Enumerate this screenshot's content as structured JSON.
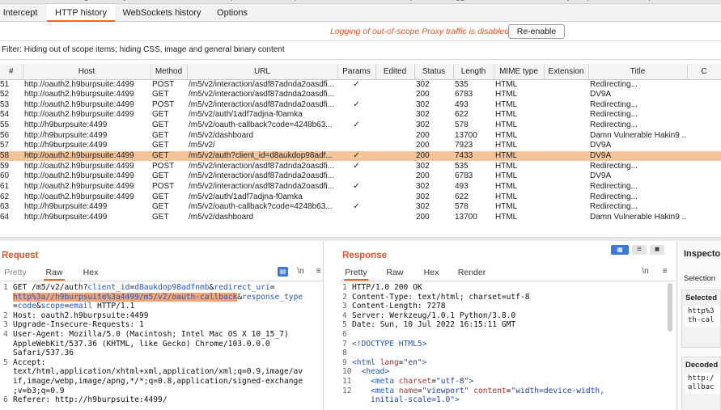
{
  "top_strip": [
    "Dashboard",
    "Target",
    "Proxy",
    "Intruder",
    "Repeater",
    "Sequencer",
    "Decoder",
    "Comparer",
    "Logger",
    "Extender",
    "Project options",
    "User options",
    "Learn"
  ],
  "tabs": [
    "Intercept",
    "HTTP history",
    "WebSockets history",
    "Options"
  ],
  "active_tab": "HTTP history",
  "log_message": "Logging of out-of-scope Proxy traffic is disabled",
  "reenable_label": "Re-enable",
  "filter_text": "Filter: Hiding out of scope items;  hiding CSS, image and general binary content",
  "columns": [
    "#",
    "Host",
    "Method",
    "URL",
    "Params",
    "Edited",
    "Status",
    "Length",
    "MIME type",
    "Extension",
    "Title",
    "C"
  ],
  "rows": [
    [
      "51",
      "http://oauth2.h9burpsuite:4499",
      "POST",
      "/m5/v2/interaction/asdf87adnda2oasdfi...",
      "✓",
      "",
      "302",
      "535",
      "HTML",
      "",
      "Redirecting..."
    ],
    [
      "52",
      "http://oauth2.h9burpsuite:4499",
      "GET",
      "/m5/v2/interaction/asdf87adnda2oasdfi...",
      "",
      "",
      "200",
      "6783",
      "HTML",
      "",
      "DV9A"
    ],
    [
      "53",
      "http://oauth2.h9burpsuite:4499",
      "POST",
      "/m5/v2/interaction/asdf87adnda2oasdfi...",
      "✓",
      "",
      "302",
      "493",
      "HTML",
      "",
      "Redirecting..."
    ],
    [
      "54",
      "http://oauth2.h9burpsuite:4499",
      "GET",
      "/m5/v2/auth/1adf7adjna-f0amka",
      "",
      "",
      "302",
      "622",
      "HTML",
      "",
      "Redirecting..."
    ],
    [
      "55",
      "http://h9burpsuite:4499",
      "GET",
      "/m5/v2/oauth-callback?code=4248b63...",
      "✓",
      "",
      "302",
      "578",
      "HTML",
      "",
      "Redirecting..."
    ],
    [
      "56",
      "http://h9burpsuite:4499",
      "GET",
      "/m5/v2/dashboard",
      "",
      "",
      "200",
      "13700",
      "HTML",
      "",
      "Damn Vulnerable Hakin9 ..."
    ],
    [
      "57",
      "http://h9burpsuite:4499",
      "GET",
      "/m5/v2/",
      "",
      "",
      "200",
      "7923",
      "HTML",
      "",
      "DV9A"
    ],
    [
      "58",
      "http://oauth2.h9burpsuite:4499",
      "GET",
      "/m5/v2/auth?client_id=d8aukdop98adf...",
      "✓",
      "",
      "200",
      "7433",
      "HTML",
      "",
      "DV9A"
    ],
    [
      "59",
      "http://oauth2.h9burpsuite:4499",
      "POST",
      "/m5/v2/interaction/asdf87adnda2oasdfi...",
      "✓",
      "",
      "302",
      "535",
      "HTML",
      "",
      "Redirecting..."
    ],
    [
      "60",
      "http://oauth2.h9burpsuite:4499",
      "GET",
      "/m5/v2/interaction/asdf87adnda2oasdfi...",
      "",
      "",
      "200",
      "6783",
      "HTML",
      "",
      "DV9A"
    ],
    [
      "61",
      "http://oauth2.h9burpsuite:4499",
      "POST",
      "/m5/v2/interaction/asdf87adnda2oasdfi...",
      "✓",
      "",
      "302",
      "493",
      "HTML",
      "",
      "Redirecting..."
    ],
    [
      "62",
      "http://oauth2.h9burpsuite:4499",
      "GET",
      "/m5/v2/auth/1adf7adjna-f0amka",
      "",
      "",
      "302",
      "622",
      "HTML",
      "",
      "Redirecting..."
    ],
    [
      "63",
      "http://h9burpsuite:4499",
      "GET",
      "/m5/v2/oauth-callback?code=4248b63...",
      "✓",
      "",
      "302",
      "578",
      "HTML",
      "",
      "Redirecting..."
    ],
    [
      "64",
      "http://h9burpsuite:4499",
      "GET",
      "/m5/v2/dashboard",
      "",
      "",
      "200",
      "13700",
      "HTML",
      "",
      "Damn Vulnerable Hakin9 ..."
    ]
  ],
  "selected_row_index": 7,
  "request": {
    "title": "Request",
    "tabs": [
      "Pretty",
      "Raw",
      "Hex"
    ],
    "active_tab": "Raw",
    "toolbar": [
      "\\n",
      "≡"
    ],
    "lines": [
      {
        "n": "1",
        "parts": [
          [
            "",
            "GET /m5/v2/auth?"
          ],
          [
            "blue",
            "client_id"
          ],
          [
            "",
            "="
          ],
          [
            "blue",
            "d8aukdop98adfnmb"
          ],
          [
            "",
            "&"
          ],
          [
            "blue",
            "redirect_uri"
          ],
          [
            "",
            "="
          ]
        ]
      },
      {
        "n": "",
        "parts": [
          [
            "hl",
            "http%3a//h9burpsuite%3a4499/m5/v2/oauth-callback"
          ],
          [
            "",
            "&"
          ],
          [
            "blue",
            "response_type"
          ]
        ]
      },
      {
        "n": "",
        "parts": [
          [
            "",
            "="
          ],
          [
            "blue",
            "code"
          ],
          [
            "",
            "&"
          ],
          [
            "blue",
            "scope"
          ],
          [
            "",
            "="
          ],
          [
            "blue",
            "email"
          ],
          [
            "",
            " HTTP/1.1"
          ]
        ]
      },
      {
        "n": "2",
        "parts": [
          [
            "",
            "Host: oauth2.h9burpsuite:4499"
          ]
        ]
      },
      {
        "n": "3",
        "parts": [
          [
            "",
            "Upgrade-Insecure-Requests: 1"
          ]
        ]
      },
      {
        "n": "4",
        "parts": [
          [
            "",
            "User-Agent: Mozilla/5.0 (Macintosh; Intel Mac OS X 10_15_7)"
          ]
        ]
      },
      {
        "n": "",
        "parts": [
          [
            "",
            "AppleWebKit/537.36 (KHTML, like Gecko) Chrome/103.0.0.0"
          ]
        ]
      },
      {
        "n": "",
        "parts": [
          [
            "",
            "Safari/537.36"
          ]
        ]
      },
      {
        "n": "5",
        "parts": [
          [
            "",
            "Accept:"
          ]
        ]
      },
      {
        "n": "",
        "parts": [
          [
            "",
            "text/html,application/xhtml+xml,application/xml;q=0.9,image/av"
          ]
        ]
      },
      {
        "n": "",
        "parts": [
          [
            "",
            "if,image/webp,image/apng,*/*;q=0.8,application/signed-exchange"
          ]
        ]
      },
      {
        "n": "",
        "parts": [
          [
            "",
            ";v=b3;q=0.9"
          ]
        ]
      },
      {
        "n": "6",
        "parts": [
          [
            "",
            "Referer: http://h9burpsuite:4499/"
          ]
        ]
      }
    ]
  },
  "response": {
    "title": "Response",
    "tabs": [
      "Pretty",
      "Raw",
      "Hex",
      "Render"
    ],
    "active_tab": "Pretty",
    "toolbar": [
      "\\n",
      "≡"
    ],
    "lines": [
      {
        "n": "1",
        "parts": [
          [
            "",
            "HTTP/1.0 200 OK"
          ]
        ]
      },
      {
        "n": "2",
        "parts": [
          [
            "",
            "Content-Type: text/html; charset=utf-8"
          ]
        ]
      },
      {
        "n": "3",
        "parts": [
          [
            "",
            "Content-Length: 7278"
          ]
        ]
      },
      {
        "n": "4",
        "parts": [
          [
            "",
            "Server: Werkzeug/1.0.1 Python/3.8.0"
          ]
        ]
      },
      {
        "n": "5",
        "parts": [
          [
            "",
            "Date: Sun, 10 Jul 2022 16:15:11 GMT"
          ]
        ]
      },
      {
        "n": "6",
        "parts": []
      },
      {
        "n": "7",
        "parts": [
          [
            "tag",
            "<!DOCTYPE HTML5>"
          ]
        ]
      },
      {
        "n": "8",
        "parts": []
      },
      {
        "n": "9",
        "parts": [
          [
            "tag",
            "<html "
          ],
          [
            "attr",
            "lang"
          ],
          [
            "",
            "="
          ],
          [
            "aval",
            "\"en\""
          ],
          [
            "tag",
            ">"
          ]
        ]
      },
      {
        "n": "10",
        "parts": [
          [
            "",
            "  "
          ],
          [
            "tag",
            "<head>"
          ]
        ]
      },
      {
        "n": "11",
        "parts": [
          [
            "",
            "    "
          ],
          [
            "tag",
            "<meta "
          ],
          [
            "attr",
            "charset"
          ],
          [
            "",
            "="
          ],
          [
            "aval",
            "\"utf-8\""
          ],
          [
            "tag",
            ">"
          ]
        ]
      },
      {
        "n": "12",
        "parts": [
          [
            "",
            "    "
          ],
          [
            "tag",
            "<meta "
          ],
          [
            "attr",
            "name"
          ],
          [
            "",
            "="
          ],
          [
            "aval",
            "\"viewport\""
          ],
          [
            "",
            " "
          ],
          [
            "attr",
            "content"
          ],
          [
            "",
            "="
          ],
          [
            "aval",
            "\"width=device-width,"
          ]
        ]
      },
      {
        "n": "",
        "parts": [
          [
            "aval",
            "    initial-scale=1.0\""
          ],
          [
            "tag",
            ">"
          ]
        ]
      }
    ]
  },
  "inspector": {
    "title": "Inspecto",
    "selection_label": "Selection",
    "selected_label": "Selected",
    "selected_value": "http%3\nth-cal",
    "decoded_label": "Decoded",
    "decoded_value": "http:/\nallbac"
  }
}
